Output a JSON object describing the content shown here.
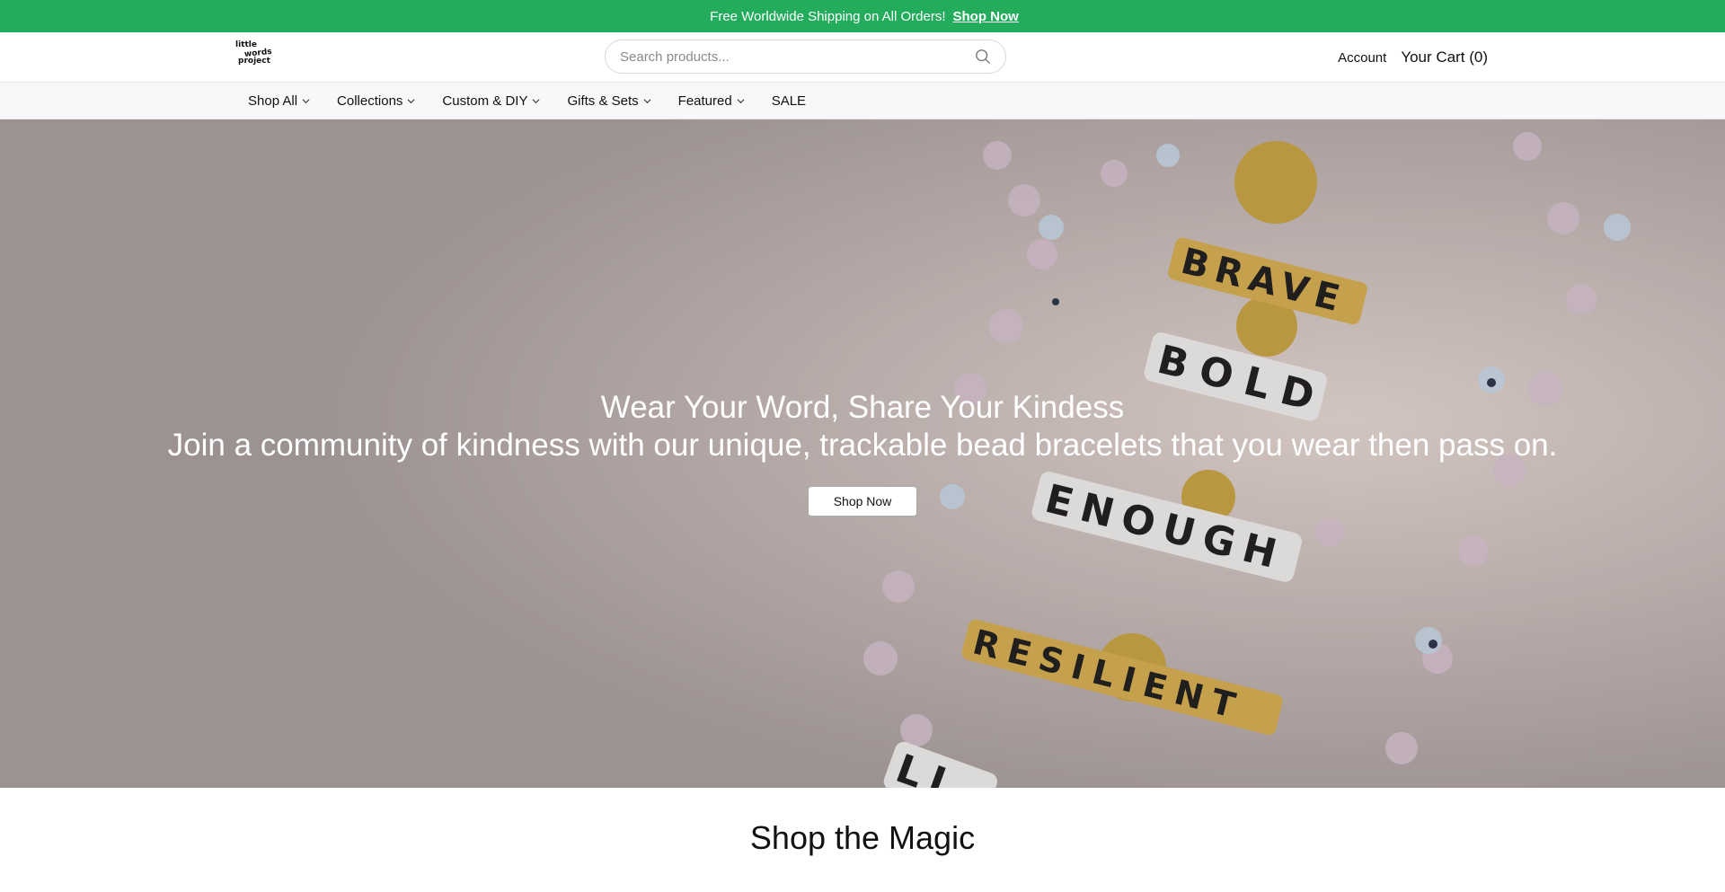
{
  "announcement": {
    "lead_glyph": "",
    "text": "Free Worldwide Shipping on All Orders!",
    "link": "Shop Now",
    "close_glyph": ""
  },
  "logo": {
    "line1": "little",
    "line2": "words",
    "line3": "project"
  },
  "search": {
    "placeholder": "Search products..."
  },
  "header": {
    "account": "Account",
    "cart": "Your Cart (0)"
  },
  "nav": {
    "items": [
      {
        "label": "Shop All"
      },
      {
        "label": "Collections"
      },
      {
        "label": "Custom & DIY"
      },
      {
        "label": "Gifts & Sets"
      },
      {
        "label": "Featured"
      },
      {
        "label": "SALE"
      }
    ]
  },
  "hero": {
    "title": "Wear Your Word, Share Your Kindess",
    "subtitle": "Join a community of kindness with our unique, trackable bead bracelets that you wear then pass on.",
    "button": "Shop Now",
    "bead_words": [
      "BRAVE",
      "BOLD",
      "ENOUGH",
      "RESILIENT",
      "LI"
    ]
  },
  "section": {
    "title": "Shop the Magic"
  },
  "colors": {
    "announcement_bg": "#22ac5c",
    "hero_bg": "#a59c9c"
  }
}
